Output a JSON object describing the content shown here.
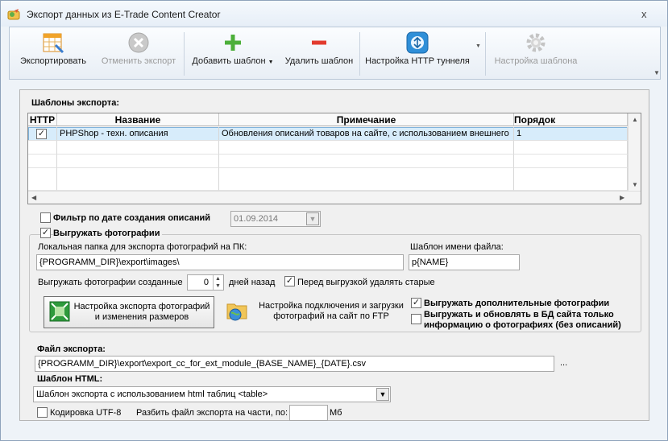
{
  "window": {
    "title": "Экспорт данных из E-Trade Content Creator",
    "close_glyph": "x"
  },
  "toolbar": {
    "export_label": "Экспортировать",
    "cancel_export_label": "Отменить экспорт",
    "add_template_label": "Добавить шаблон",
    "delete_template_label": "Удалить шаблон",
    "http_tunnel_label": "Настройка HTTP туннеля",
    "template_settings_label": "Настройка шаблона"
  },
  "templates": {
    "heading": "Шаблоны экспорта:",
    "columns": [
      "HTTP",
      "Название",
      "Примечание",
      "Порядок"
    ],
    "rows": [
      {
        "http": true,
        "name": "PHPShop - техн. описания",
        "note": "Обновления описаний товаров на сайте, с использованием внешнего",
        "order": "1"
      }
    ]
  },
  "date_filter": {
    "label": "Фильтр по дате создания описаний",
    "checked": false,
    "value": "01.09.2014"
  },
  "photos": {
    "checkbox_label": "Выгружать фотографии",
    "checked": true,
    "local_folder_label": "Локальная папка для экспорта фотографий на ПК:",
    "local_folder_value": "{PROGRAMM_DIR}\\export\\images\\",
    "filename_template_label": "Шаблон имени файла:",
    "filename_template_value": "p{NAME}",
    "created_label": "Выгружать фотографии созданные",
    "created_days": "0",
    "days_ago_label": "дней назад",
    "delete_old_label": "Перед выгрузкой удалять старые",
    "delete_old_checked": true,
    "resize_button": "Настройка экспорта фотографий и изменения размеров",
    "ftp_button": "Настройка подключения и загрузки фотографий на сайт по FTP",
    "extra_photos_label": "Выгружать дополнительные фотографии",
    "extra_photos_checked": true,
    "only_photo_info_label": "Выгружать и обновлять в БД сайта только информацию о фотографиях (без описаний)",
    "only_photo_info_checked": false
  },
  "export_file": {
    "label": "Файл экспорта:",
    "value": "{PROGRAMM_DIR}\\export\\export_cc_for_ext_module_{BASE_NAME}_{DATE}.csv",
    "browse": "..."
  },
  "html_template": {
    "label": "Шаблон HTML:",
    "value": "Шаблон экспорта с использованием html таблиц <table>"
  },
  "encoding": {
    "label": "Кодировка UTF-8",
    "checked": false
  },
  "split": {
    "label": "Разбить файл экспорта на части, по:",
    "value": "",
    "unit": "Мб"
  }
}
